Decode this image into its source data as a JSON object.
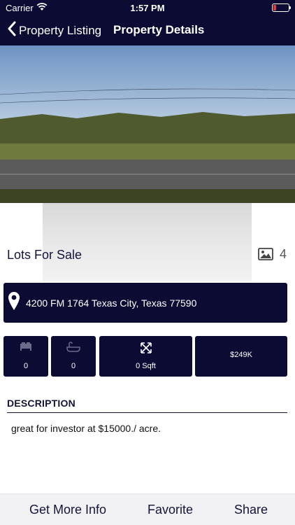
{
  "status_bar": {
    "carrier": "Carrier",
    "time": "1:57 PM"
  },
  "nav": {
    "back_label": "Property Listing",
    "title": "Property Details"
  },
  "listing": {
    "title": "Lots For Sale",
    "photo_count": "4",
    "address": "4200 FM 1764 Texas City, Texas 77590"
  },
  "stats": {
    "bedrooms": "0",
    "bathrooms": "0",
    "area": "0 Sqft",
    "price": "$249K"
  },
  "description": {
    "heading": "DESCRIPTION",
    "text": "great for investor at $15000./ acre."
  },
  "actions": {
    "more_info": "Get More Info",
    "favorite": "Favorite",
    "share": "Share"
  },
  "colors": {
    "primary": "#0c0b33",
    "action_bar": "#f2f2f4",
    "battery_low": "#e53935"
  }
}
